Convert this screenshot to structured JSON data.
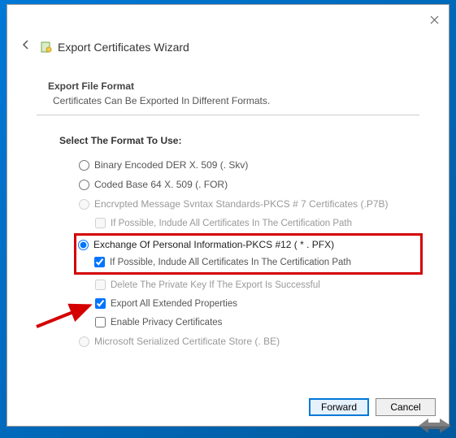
{
  "window": {
    "title": "Export Certificates Wizard"
  },
  "page": {
    "heading": "Export File Format",
    "description": "Certificates Can Be Exported In Different Formats.",
    "instruction": "Select The Format To Use:"
  },
  "options": [
    {
      "label": "Binary Encoded DER X. 509 (. Skv)",
      "selected": false,
      "enabled": true,
      "subs": []
    },
    {
      "label": "Coded Base 64 X. 509 (. FOR)",
      "selected": false,
      "enabled": true,
      "subs": []
    },
    {
      "label": "Encrvpted Message Svntax Standards-PKCS # 7 Certificates (.P7B)",
      "selected": false,
      "enabled": false,
      "subs": [
        {
          "label": "If Possible, Indude All Certificates In The Certification Path",
          "checked": false,
          "enabled": false
        }
      ]
    },
    {
      "label": "Exchange Of Personal Information-PKCS #12 ( * . PFX)",
      "selected": true,
      "enabled": true,
      "subs": [
        {
          "label": "If Possible, Indude All Certificates In The Certification Path",
          "checked": true,
          "enabled": true
        },
        {
          "label": "Delete The Private Key If The Export Is Successful",
          "checked": false,
          "enabled": false
        },
        {
          "label": "Export All Extended Properties",
          "checked": true,
          "enabled": true
        },
        {
          "label": "Enable Privacy Certificates",
          "checked": false,
          "enabled": true
        }
      ]
    },
    {
      "label": "Microsoft Serialized Certificate Store (. BE)",
      "selected": false,
      "enabled": false,
      "subs": []
    }
  ],
  "buttons": {
    "forward": "Forward",
    "cancel": "Cancel"
  }
}
